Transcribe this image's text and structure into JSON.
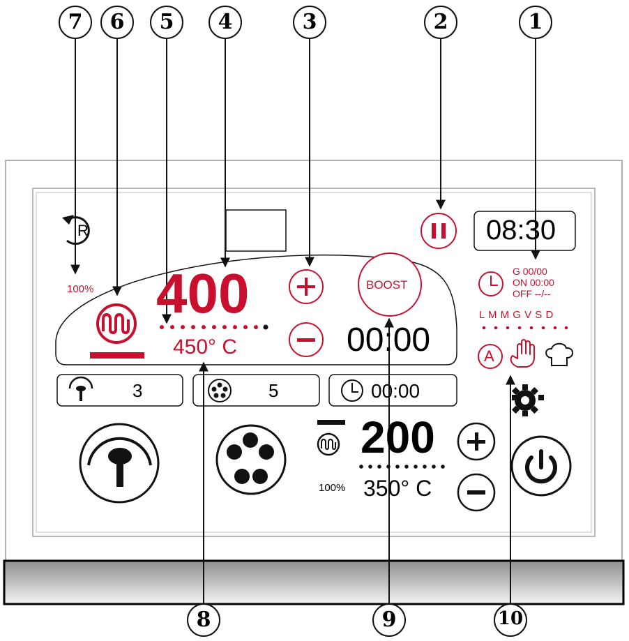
{
  "callouts": [
    "1",
    "2",
    "3",
    "4",
    "5",
    "6",
    "7",
    "8",
    "9",
    "10"
  ],
  "colors": {
    "accent": "#c8102e",
    "ink": "#111111",
    "frame": "#9a9a9a"
  },
  "icons": [
    "reset-icon",
    "pause-icon",
    "heater-icon",
    "clock-icon",
    "hand-icon",
    "chef-hat-icon",
    "fan-icon",
    "burner-icon",
    "gear-icon",
    "power-icon"
  ],
  "top": {
    "reset_letter": "R",
    "clock": "08:30",
    "boost_label": "BOOST",
    "schedule": {
      "g": "G 00/00",
      "on": "ON 00:00",
      "off": "OFF --/--"
    },
    "days": "L M M G V S D",
    "auto_letter": "A"
  },
  "zone1": {
    "power_pct": "100%",
    "value": "400",
    "temperature": "450° C",
    "timer": "00:00",
    "plus": "+",
    "minus": "−"
  },
  "info_bar": {
    "fan_level": "3",
    "burner_level": "5",
    "timer": "00:00"
  },
  "zone2": {
    "power_pct": "100%",
    "value": "200",
    "temperature": "350° C",
    "plus": "+",
    "minus": "−"
  }
}
